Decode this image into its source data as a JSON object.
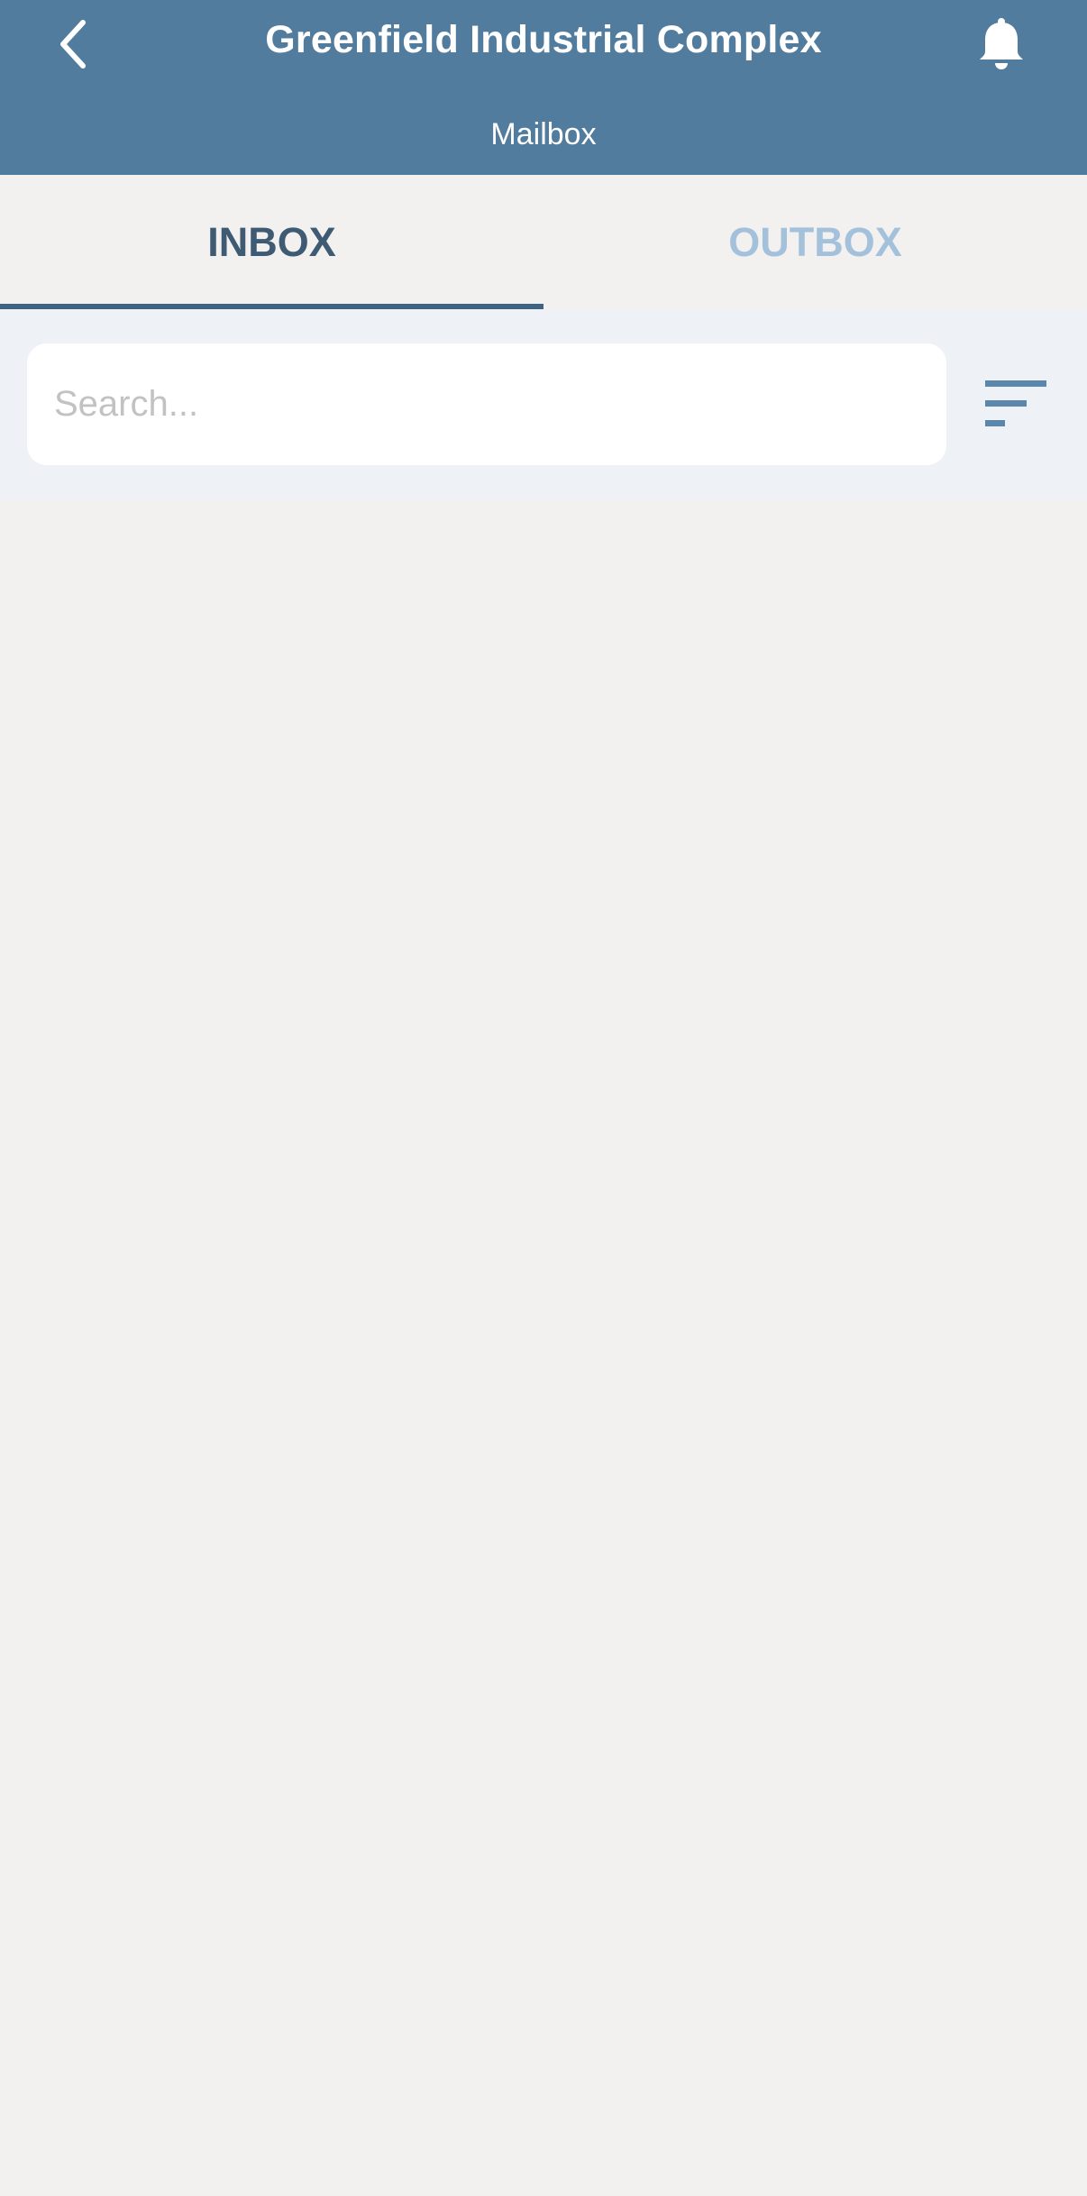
{
  "header": {
    "title": "Greenfield Industrial Complex",
    "subtitle": "Mailbox",
    "back_icon": "chevron-left-icon",
    "notification_icon": "bell-icon",
    "background_color": "#527c9e"
  },
  "tabs": [
    {
      "label": "INBOX",
      "active": true
    },
    {
      "label": "OUTBOX",
      "active": false
    }
  ],
  "search": {
    "placeholder": "Search...",
    "value": ""
  },
  "filter": {
    "icon": "filter-sort-icon"
  },
  "messages": []
}
